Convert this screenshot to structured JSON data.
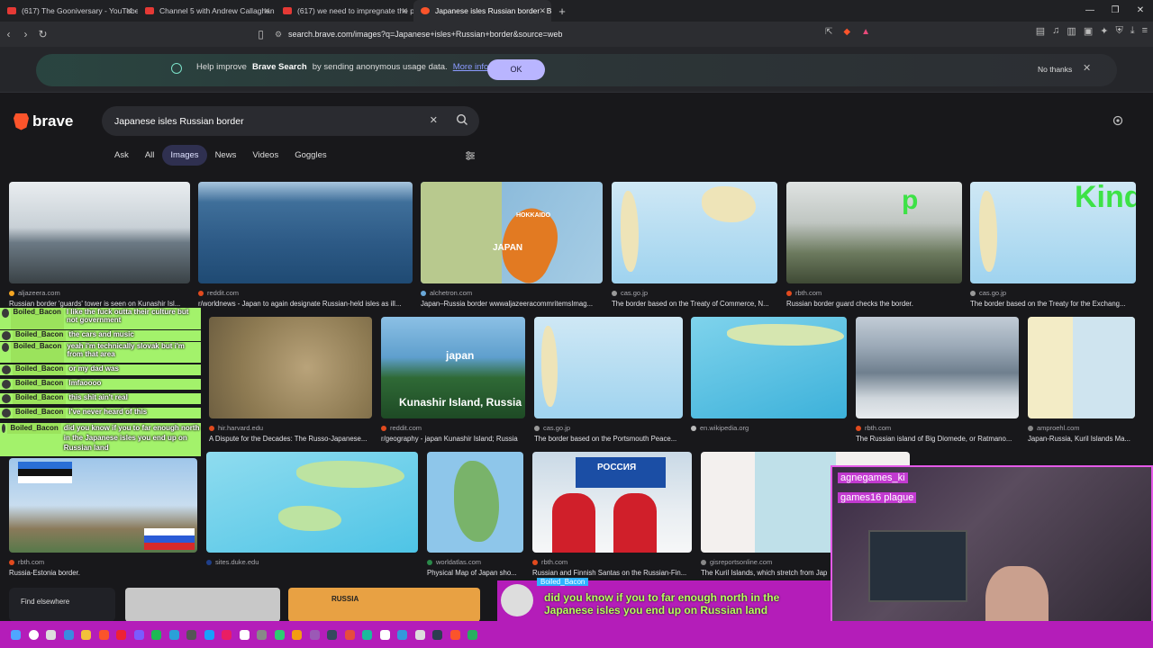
{
  "tabs": [
    {
      "title": "(617) The Gooniversary - YouTube",
      "kind": "youtube"
    },
    {
      "title": "Channel 5 with Andrew Callaghan - Y",
      "kind": "youtube"
    },
    {
      "title": "(617) we need to impregnate the pre",
      "kind": "youtube"
    },
    {
      "title": "Japanese isles Russian border - B",
      "kind": "brave",
      "active": true
    }
  ],
  "address": {
    "url": "search.brave.com/images?q=Japanese+isles+Russian+border&source=web"
  },
  "banner": {
    "prefix": "Help improve",
    "brand": "Brave Search",
    "suffix": "by sending anonymous usage data.",
    "more": "More info",
    "ok": "OK",
    "no_thanks": "No thanks"
  },
  "search": {
    "logo": "brave",
    "query": "Japanese isles Russian border"
  },
  "nav_tabs": [
    "Ask",
    "All",
    "Images",
    "News",
    "Videos",
    "Goggles"
  ],
  "active_nav": "Images",
  "images": [
    {
      "source": "aljazeera.com",
      "caption": "Russian border 'guards' tower is seen on Kunashir Isl..."
    },
    {
      "source": "reddit.com",
      "caption": "r/worldnews - Japan to again designate Russian-held isles as ill..."
    },
    {
      "source": "alchetron.com",
      "caption": "Japan–Russia border wwwaljazeeracommritemsImag..."
    },
    {
      "source": "cas.go.jp",
      "caption": "The border based on the Treaty of Commerce, N..."
    },
    {
      "source": "rbth.com",
      "caption": "Russian border guard checks the border."
    },
    {
      "source": "cas.go.jp",
      "caption": "The border based on the Treaty for the Exchang..."
    },
    {
      "source": "hir.harvard.edu",
      "caption": "A Dispute for the Decades: The Russo-Japanese..."
    },
    {
      "source": "reddit.com",
      "caption": "r/geography - japan Kunashir Island; Russia"
    },
    {
      "source": "cas.go.jp",
      "caption": "The border based on the Portsmouth Peace..."
    },
    {
      "source": "en.wikipedia.org",
      "caption": ""
    },
    {
      "source": "rbth.com",
      "caption": "The Russian island of Big Diomede, or Ratmano..."
    },
    {
      "source": "amproehl.com",
      "caption": "Japan-Russia, Kuril Islands Ma..."
    },
    {
      "source": "rbth.com",
      "caption": "Russia-Estonia border."
    },
    {
      "source": "sites.duke.edu",
      "caption": ""
    },
    {
      "source": "worldatlas.com",
      "caption": "Physical Map of Japan sho..."
    },
    {
      "source": "rbth.com",
      "caption": "Russian and Finnish Santas on the Russian-Fin..."
    },
    {
      "source": "gisreportsonline.com",
      "caption": "The Kuril Islands, which stretch from Jap"
    }
  ],
  "image_labels": {
    "hokkaido": "HOKKAIDO",
    "japan": "JAPAN",
    "japan_lower": "japan",
    "kunashir": "Kunashir Island, Russia",
    "rossiya": "РОССИЯ",
    "russia": "RUSSIA",
    "overlay_p": "p",
    "overlay_kinda": "Kinda"
  },
  "find_elsewhere": "Find elsewhere",
  "chat": [
    {
      "user": "Boiled_Bacon",
      "text": "I like the fuck outta their culture but not government"
    },
    {
      "user": "Boiled_Bacon",
      "text": "the cars and music"
    },
    {
      "user": "Boiled_Bacon",
      "text": "yeah i'm technically slovak but i'm from that area"
    },
    {
      "user": "Boiled_Bacon",
      "text": "or my dad was"
    },
    {
      "user": "Boiled_Bacon",
      "text": "lmfaoooo"
    },
    {
      "user": "Boiled_Bacon",
      "text": "this shit ain't real"
    },
    {
      "user": "Boiled_Bacon",
      "text": "i've never heard of this"
    },
    {
      "user": "Boiled_Bacon",
      "text": "did you know if you to far enough north in the Japanese isles you end up on Russian land"
    }
  ],
  "overlay_text": "did you know if you to far enough north in the Japanese isles you end up on Russian land",
  "overlay_user": "Boiled_Bacon",
  "webcam_labels": [
    "agnegames_ki",
    "games16 plague"
  ],
  "colors": {
    "accent": "#b9b5ff",
    "brave": "#fb542b",
    "chat": "#a3f26b",
    "overlay": "#b41db9"
  }
}
